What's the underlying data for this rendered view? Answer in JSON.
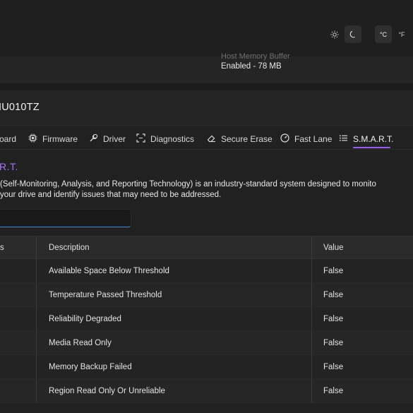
{
  "header": {
    "theme": {
      "light_icon": "sun-icon",
      "dark_icon": "moon-icon"
    },
    "units": {
      "celsius": "°C",
      "fahrenheit": "°F"
    }
  },
  "info_card": {
    "host_memory_buffer_label": "Host Memory Buffer",
    "host_memory_buffer_value": "Enabled - 78 MB"
  },
  "drive": {
    "name": "IU010TZ"
  },
  "tabs": [
    {
      "label": "oard",
      "icon": "dashboard-icon"
    },
    {
      "label": "Firmware",
      "icon": "chip-icon"
    },
    {
      "label": "Driver",
      "icon": "wrench-icon"
    },
    {
      "label": "Diagnostics",
      "icon": "scan-icon"
    },
    {
      "label": "Secure Erase",
      "icon": "eraser-icon"
    },
    {
      "label": "Fast Lane",
      "icon": "gauge-icon"
    },
    {
      "label": "S.M.A.R.T.",
      "icon": "list-icon",
      "active": true
    }
  ],
  "smart": {
    "title": "R.T.",
    "description_line1": "(Self-Monitoring, Analysis, and Reporting Technology) is an industry-standard system designed to monito",
    "description_line2": "your drive and identify issues that may need to be addressed.",
    "search_placeholder": "",
    "accent_color": "#a970ff",
    "underline_color": "#9b5cf6"
  },
  "table": {
    "columns": [
      "s",
      "Description",
      "Value"
    ],
    "rows": [
      {
        "description": "Available Space Below Threshold",
        "value": "False"
      },
      {
        "description": "Temperature Passed Threshold",
        "value": "False"
      },
      {
        "description": "Reliability Degraded",
        "value": "False"
      },
      {
        "description": "Media Read Only",
        "value": "False"
      },
      {
        "description": "Memory Backup Failed",
        "value": "False"
      },
      {
        "description": "Region Read Only Or Unreliable",
        "value": "False"
      }
    ]
  }
}
